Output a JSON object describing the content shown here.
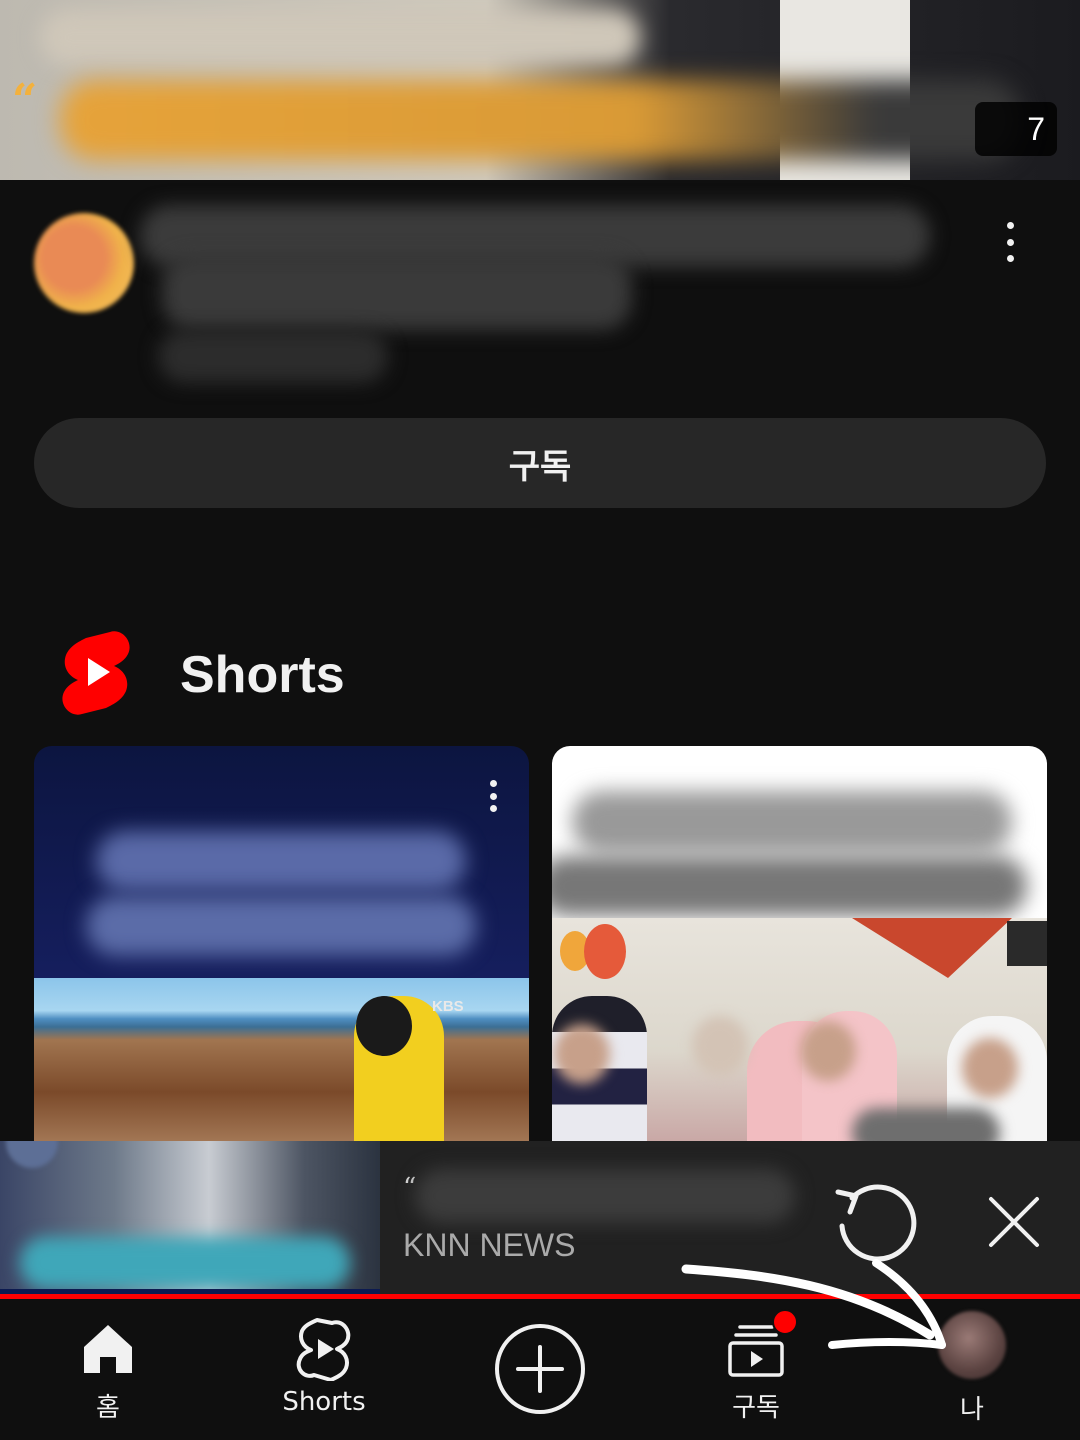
{
  "video": {
    "duration": "7",
    "title_blurred": true
  },
  "channel": {
    "subscribe_label": "구독",
    "info_blurred": true
  },
  "shorts": {
    "title": "Shorts",
    "watermark": "KBS"
  },
  "mini_player": {
    "channel": "KNN NEWS",
    "quote_mark": "“"
  },
  "nav": {
    "items": [
      {
        "label": "홈",
        "icon": "home-icon"
      },
      {
        "label": "Shorts",
        "icon": "shorts-icon"
      },
      {
        "label": "",
        "icon": "create-plus-icon"
      },
      {
        "label": "구독",
        "icon": "subscriptions-icon",
        "has_notification_dot": true
      },
      {
        "label": "나",
        "icon": "profile-avatar"
      }
    ]
  },
  "colors": {
    "accent": "#ff0000",
    "background": "#0f0f0f",
    "button": "#272727"
  }
}
